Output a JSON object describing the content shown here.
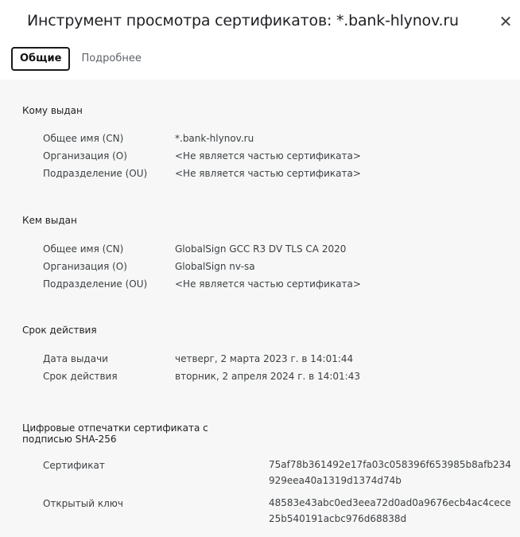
{
  "dialog": {
    "title": "Инструмент просмотра сертификатов: *.bank-hlynov.ru",
    "close_glyph": "✕"
  },
  "tabs": [
    {
      "label": "Общие",
      "active": true
    },
    {
      "label": "Подробнее",
      "active": false
    }
  ],
  "issued_to": {
    "title": "Кому выдан",
    "rows": [
      {
        "label": "Общее имя (CN)",
        "value": "*.bank-hlynov.ru"
      },
      {
        "label": "Организация (O)",
        "value": "<Не является частью сертификата>"
      },
      {
        "label": "Подразделение (OU)",
        "value": "<Не является частью сертификата>"
      }
    ]
  },
  "issued_by": {
    "title": "Кем выдан",
    "rows": [
      {
        "label": "Общее имя (CN)",
        "value": "GlobalSign GCC R3 DV TLS CA 2020"
      },
      {
        "label": "Организация (O)",
        "value": "GlobalSign nv-sa"
      },
      {
        "label": "Подразделение (OU)",
        "value": "<Не является частью сертификата>"
      }
    ]
  },
  "validity": {
    "title": "Срок действия",
    "rows": [
      {
        "label": "Дата выдачи",
        "value": "четверг, 2 марта 2023 г. в 14:01:44"
      },
      {
        "label": "Срок действия",
        "value": "вторник, 2 апреля 2024 г. в 14:01:43"
      }
    ]
  },
  "fingerprints": {
    "title": "Цифровые отпечатки сертификата с подписью SHA-256",
    "rows": [
      {
        "label": "Сертификат",
        "value": "75af78b361492e17fa03c058396f653985b8afb234929eea40a1319d1374d74b"
      },
      {
        "label": "Открытый ключ",
        "value": "48583e43abc0ed3eea72d0ad0a9676ecb4ac4cece25b540191acbc976d68838d"
      }
    ]
  },
  "colors": {
    "content_background": "#f7f7f7",
    "text": "#3c4043",
    "active_tab_border": "#1a1a1a"
  }
}
